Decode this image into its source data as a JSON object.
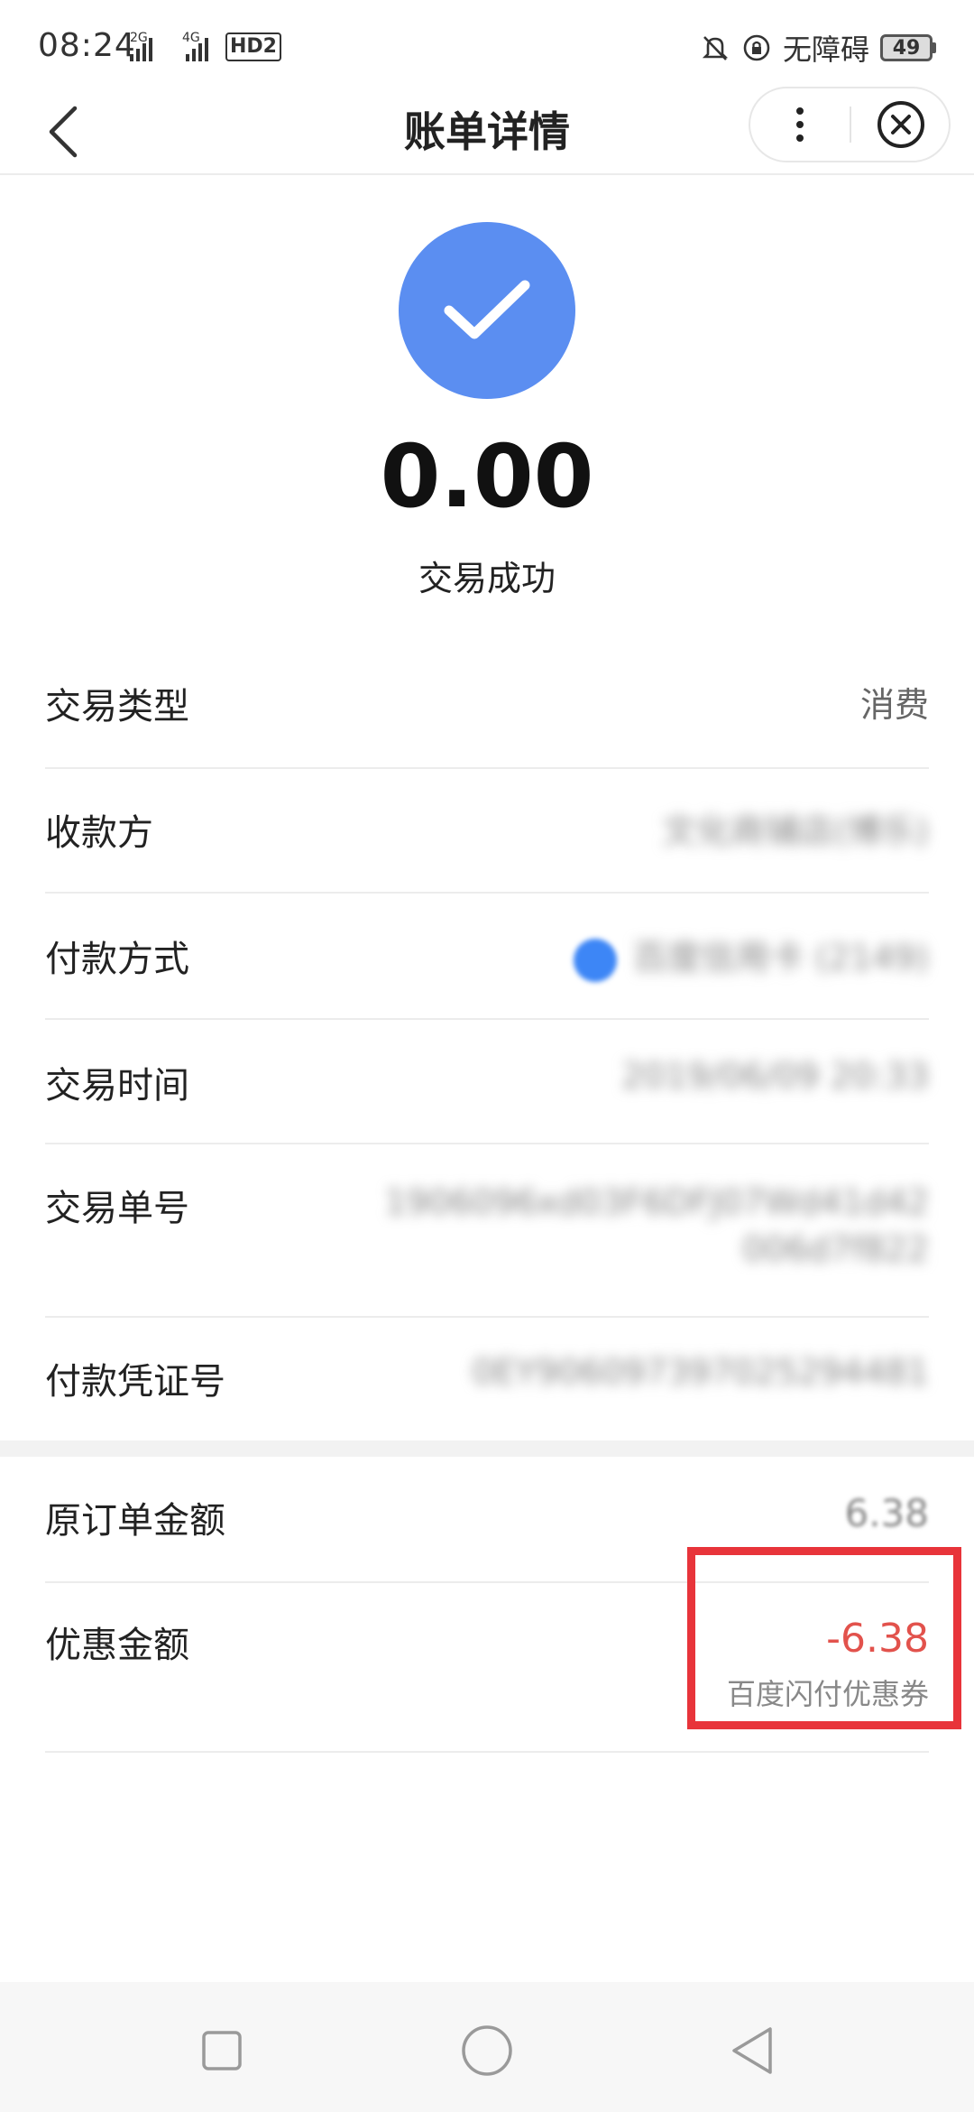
{
  "status_bar": {
    "time": "08:24",
    "network_1": "2G",
    "network_2": "4G",
    "hd_label": "HD2",
    "accessibility_label": "无障碍",
    "battery_level": "49"
  },
  "nav": {
    "title": "账单详情"
  },
  "summary": {
    "amount": "0.00",
    "status": "交易成功",
    "icon_color": "#5b8ef1"
  },
  "details": {
    "type_label": "交易类型",
    "type_value": "消费",
    "payee_label": "收款方",
    "payee_value": "文化商铺店(博乐)",
    "payment_label": "付款方式",
    "payment_value": "百度信用卡 (2149)",
    "time_label": "交易时间",
    "time_value": "2019/06/09 20:33",
    "order_label": "交易单号",
    "order_value_1": "1906096xd03F6DFJ07Wd41d42",
    "order_value_2": "006d7f822",
    "voucher_label": "付款凭证号",
    "voucher_value": "0EY906097397025294481"
  },
  "amounts": {
    "original_label": "原订单金额",
    "original_value": "6.38",
    "discount_label": "优惠金额",
    "discount_value": "-6.38",
    "discount_source": "百度闪付优惠券",
    "discount_color": "#e2524c",
    "highlight_color": "#e8343a"
  }
}
